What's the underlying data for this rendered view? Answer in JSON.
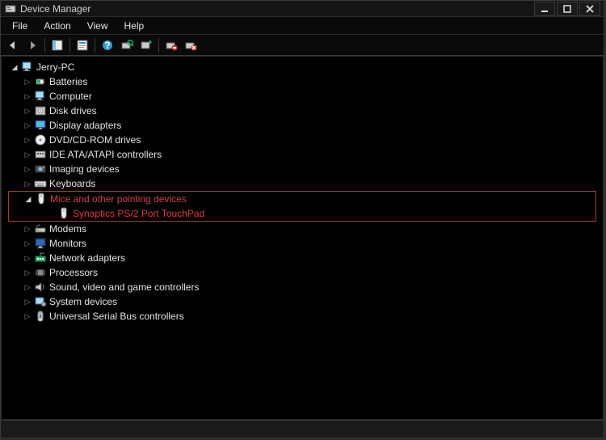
{
  "window": {
    "title": "Device Manager"
  },
  "menu": {
    "file": "File",
    "action": "Action",
    "view": "View",
    "help": "Help"
  },
  "tree": {
    "root": "Jerry-PC",
    "nodes": [
      {
        "label": "Batteries",
        "icon": "battery"
      },
      {
        "label": "Computer",
        "icon": "computer"
      },
      {
        "label": "Disk drives",
        "icon": "disk"
      },
      {
        "label": "Display adapters",
        "icon": "display"
      },
      {
        "label": "DVD/CD-ROM drives",
        "icon": "dvd"
      },
      {
        "label": "IDE ATA/ATAPI controllers",
        "icon": "ide"
      },
      {
        "label": "Imaging devices",
        "icon": "imaging"
      },
      {
        "label": "Keyboards",
        "icon": "keyboard"
      },
      {
        "label": "Mice and other pointing devices",
        "icon": "mouse",
        "expanded": true,
        "highlight": true,
        "children": [
          {
            "label": "Synaptics PS/2 Port TouchPad",
            "icon": "mouse",
            "highlight": true
          }
        ]
      },
      {
        "label": "Modems",
        "icon": "modem"
      },
      {
        "label": "Monitors",
        "icon": "monitor"
      },
      {
        "label": "Network adapters",
        "icon": "network"
      },
      {
        "label": "Processors",
        "icon": "cpu"
      },
      {
        "label": "Sound, video and game controllers",
        "icon": "sound"
      },
      {
        "label": "System devices",
        "icon": "system"
      },
      {
        "label": "Universal Serial Bus controllers",
        "icon": "usb"
      }
    ]
  }
}
